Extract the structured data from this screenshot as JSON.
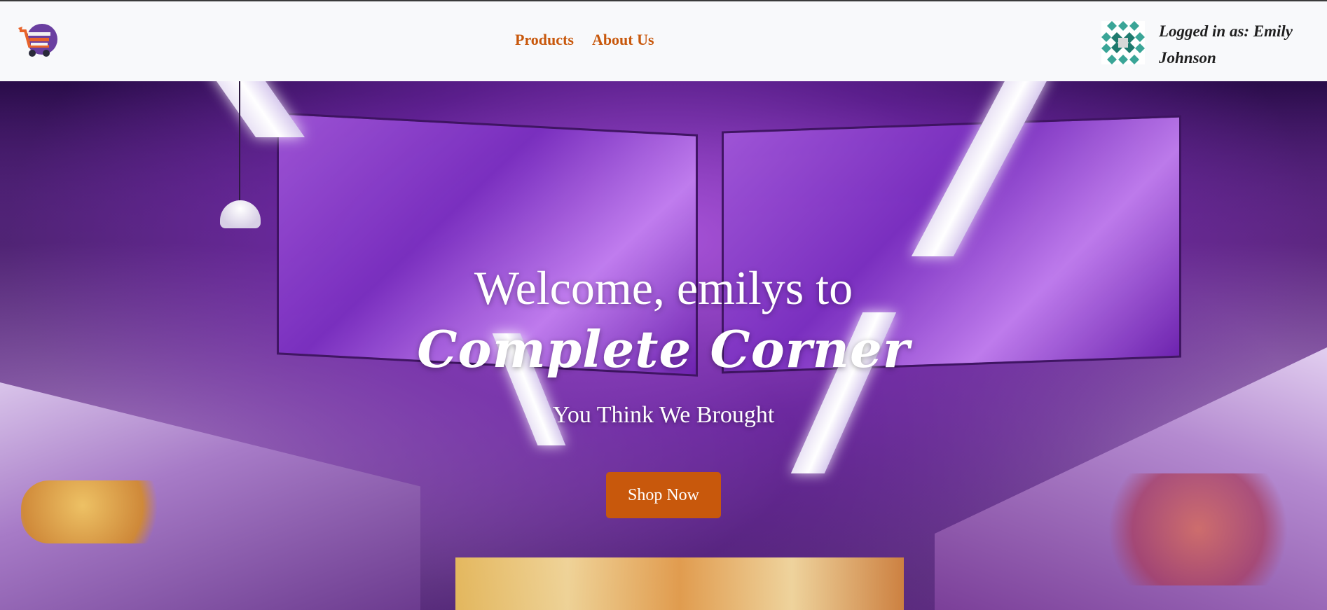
{
  "header": {
    "logo_icon": "shopping-cart-icon",
    "nav": [
      {
        "label": "Products"
      },
      {
        "label": "About Us"
      }
    ],
    "user": {
      "avatar_icon": "identicon-avatar",
      "logged_in_text": "Logged in as: Emily Johnson"
    }
  },
  "hero": {
    "welcome": "Welcome, emilys to",
    "brand": "Complete Corner",
    "tagline": "You Think We Brought",
    "cta_label": "Shop Now"
  },
  "colors": {
    "accent": "#c8580c",
    "header_bg": "#f8f9fb",
    "avatar": "#3aa597"
  }
}
